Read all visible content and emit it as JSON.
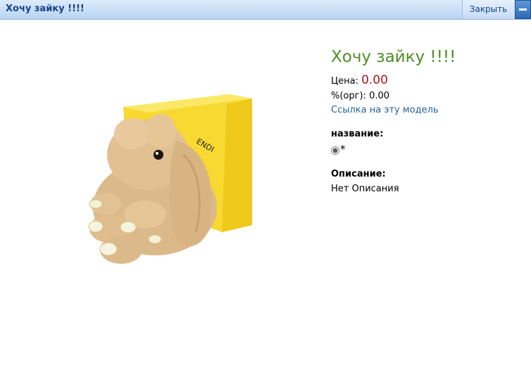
{
  "window": {
    "title": "Хочу зайку !!!!",
    "close_label": "Закрыть",
    "minimize_icon": "minimize-icon"
  },
  "product": {
    "title": "Хочу зайку !!!!",
    "price_label": "Цена:",
    "price_value": "0.00",
    "org_label": "%(орг):",
    "org_value": "0.00",
    "model_link": "Ссылка на эту модель",
    "name_heading": "название:",
    "option_label": "*",
    "option_selected": true,
    "description_heading": "Описание:",
    "description_text": "Нет Описания",
    "image_subject": "plush bunny toy on yellow box",
    "box_text": "ENDI"
  },
  "colors": {
    "title_green": "#4f8f25",
    "price_red": "#b0141c",
    "link_blue": "#2a5f9b",
    "titlebar_text": "#15428b"
  }
}
